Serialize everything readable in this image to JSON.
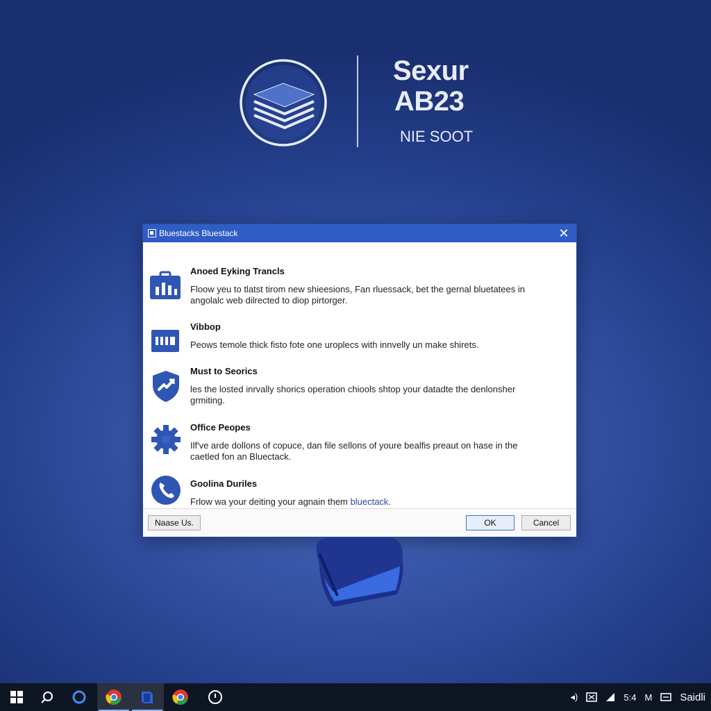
{
  "logo": {
    "line1": "Sexur",
    "line2": "AB23",
    "subtitle": "NIE SOOT"
  },
  "dialog": {
    "title": "Bluestacks Bluestack",
    "close_glyph": "✕",
    "items": [
      {
        "heading": "Anoed Eyking Trancls",
        "desc": "Floow yeu to tlatst tirom new shieesions, Fan rluessack, bet the gernal bluetatees in angolalc web dilrected to diop pirtorger.",
        "icon": "chart-case-icon"
      },
      {
        "heading": "Vibbop",
        "desc": "Peows temole thick fisto fote one uroplecs with innvelly un make shirets.",
        "icon": "panel-icon"
      },
      {
        "heading": "Must to Seorics",
        "desc": "les the losted inrvally shorics operation chiools shtop your datadte the denlonsher grmiting.",
        "icon": "shield-icon"
      },
      {
        "heading": "Office Peopes",
        "desc": "Ilf've arde dollons of copuce, dan file sellons of youre bealfis preaut on hase in the caetled fon an Bluectack.",
        "icon": "gear-icon"
      },
      {
        "heading": "Goolina Duriles",
        "desc_prefix": "Frlow wa your deiting your agnain them ",
        "desc_link": "bluectack.",
        "icon": "phone-icon"
      }
    ],
    "buttons": {
      "name": "Naase Us.",
      "ok": "OK",
      "cancel": "Cancel"
    }
  },
  "taskbar": {
    "tray": {
      "volume": "◂)",
      "time": "5:4",
      "language": "M",
      "user": "Saidli"
    }
  },
  "colors": {
    "accent": "#2f5cc5",
    "icon_blue": "#2f55b5",
    "taskbar": "#0e1624"
  }
}
